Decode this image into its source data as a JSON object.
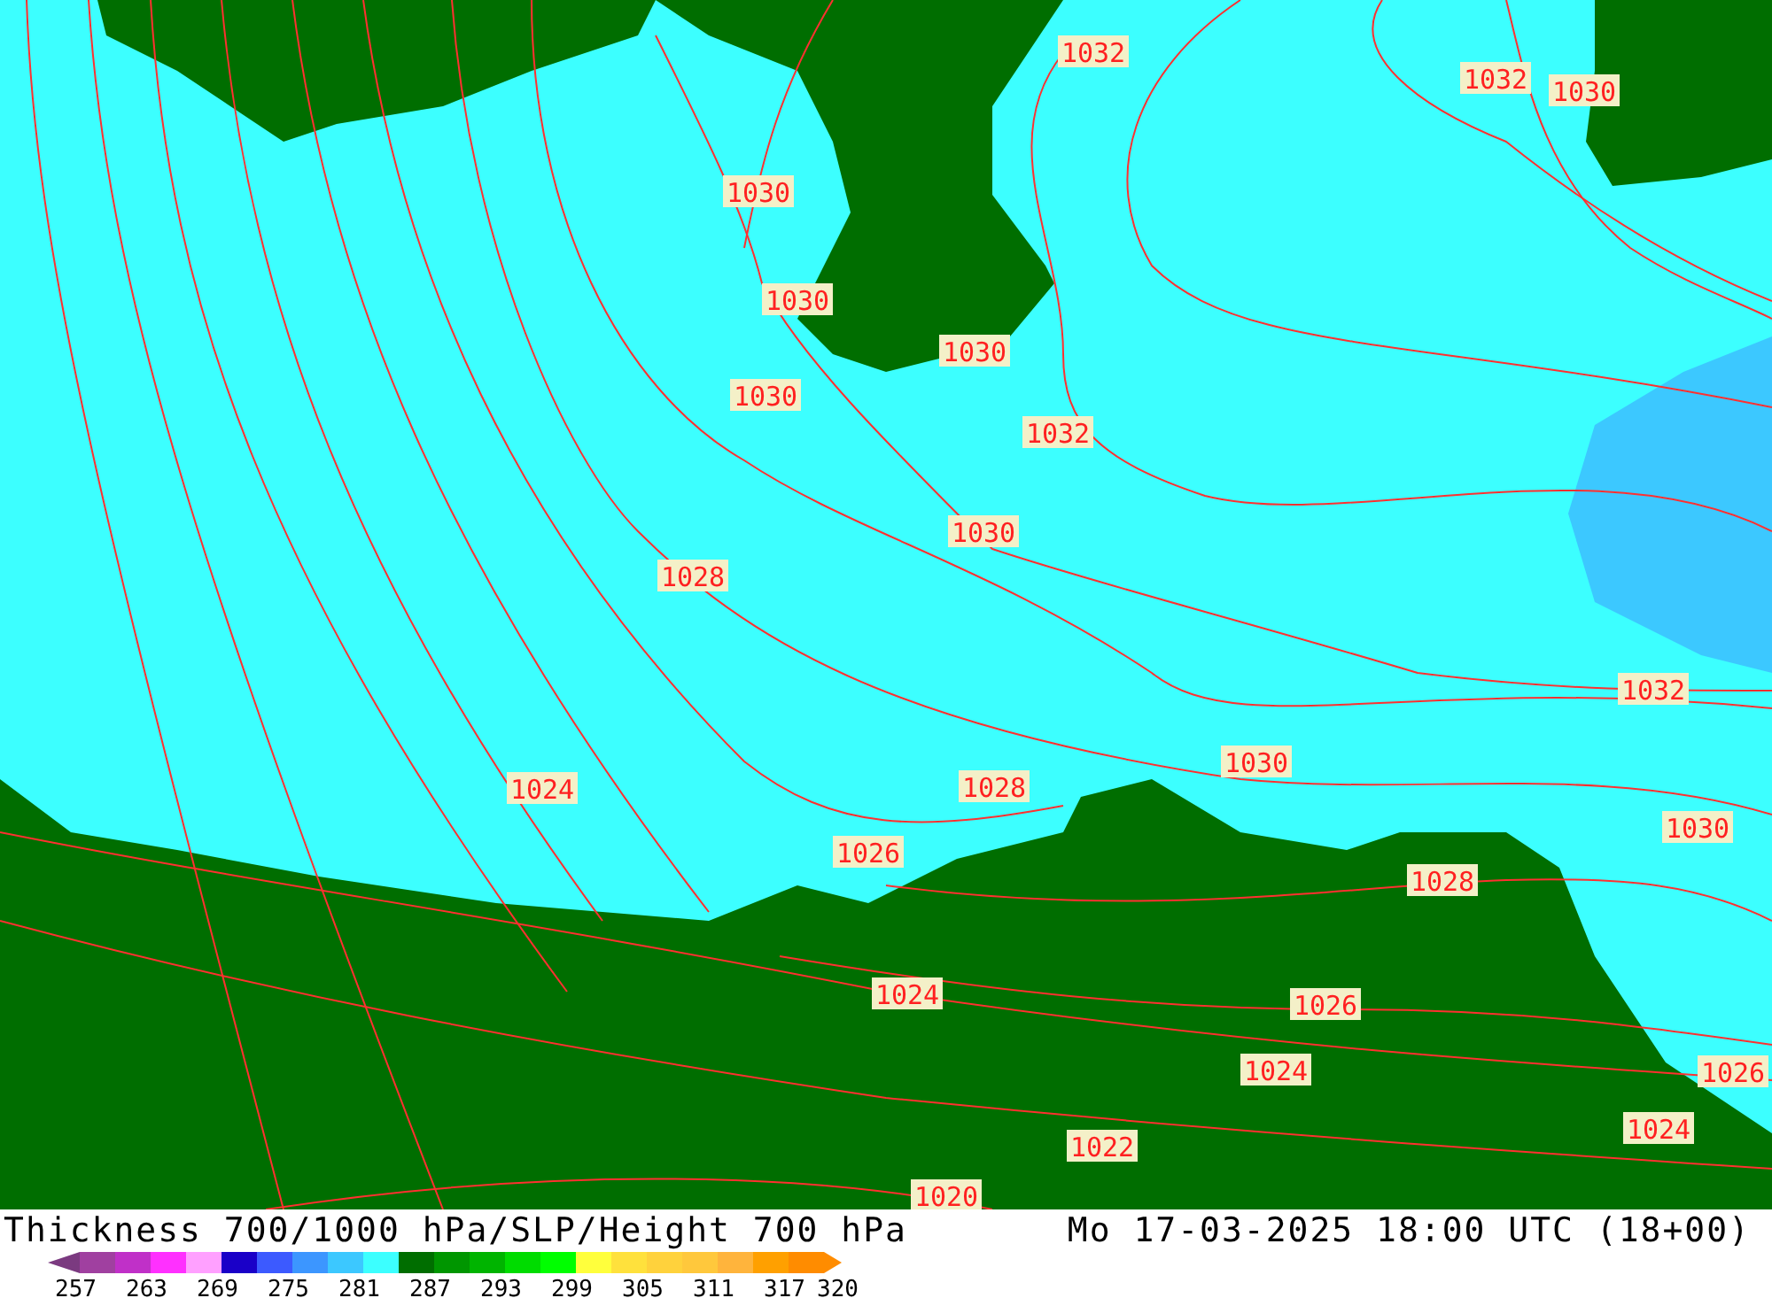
{
  "map": {
    "isobar_labels": [
      "1032",
      "1032",
      "1030",
      "1030",
      "1030",
      "1030",
      "1030",
      "1032",
      "1030",
      "1028",
      "1032",
      "1030",
      "1024",
      "1028",
      "1030",
      "1026",
      "1028",
      "1024",
      "1026",
      "1024",
      "1026",
      "1024",
      "1022",
      "1020"
    ]
  },
  "footer": {
    "title": "Thickness 700/1000 hPa/SLP/Height 700 hPa",
    "datetime": "Mo 17-03-2025 18:00 UTC (18+00)"
  },
  "legend": {
    "swatches": [
      {
        "color": "#a040a0"
      },
      {
        "color": "#c030c8"
      },
      {
        "color": "#ff30ff"
      },
      {
        "color": "#ffa0ff"
      },
      {
        "color": "#1a00c8"
      },
      {
        "color": "#3c5aff"
      },
      {
        "color": "#3c96ff"
      },
      {
        "color": "#3cc8ff"
      },
      {
        "color": "#3cffff"
      },
      {
        "color": "#006e00"
      },
      {
        "color": "#009600"
      },
      {
        "color": "#00b400"
      },
      {
        "color": "#00dc00"
      },
      {
        "color": "#00ff00"
      },
      {
        "color": "#ffff3c"
      },
      {
        "color": "#ffe13c"
      },
      {
        "color": "#ffd23c"
      },
      {
        "color": "#ffc83c"
      },
      {
        "color": "#ffb43c"
      },
      {
        "color": "#ffa000"
      },
      {
        "color": "#ff8c00"
      }
    ],
    "ticks": [
      "257",
      "263",
      "269",
      "275",
      "281",
      "287",
      "293",
      "299",
      "305",
      "311",
      "317",
      "320"
    ]
  }
}
